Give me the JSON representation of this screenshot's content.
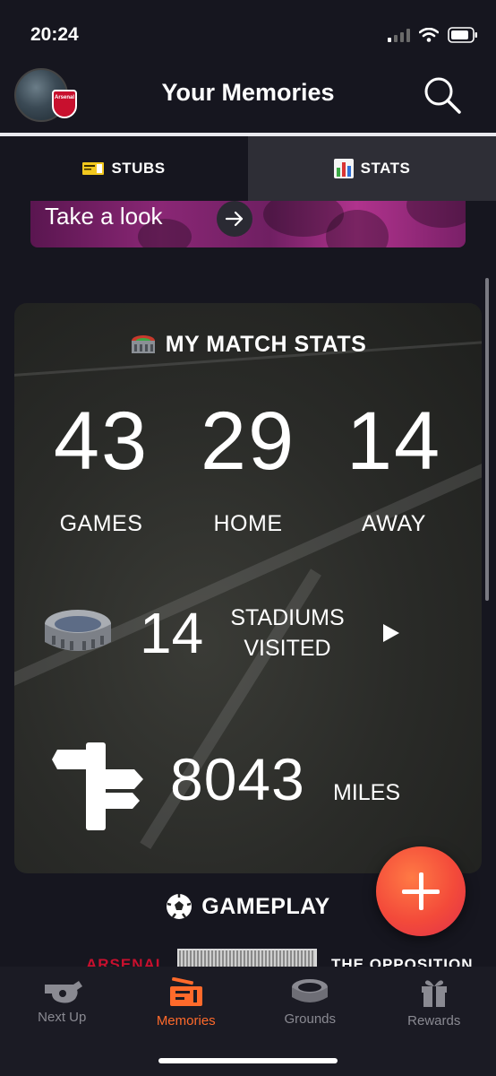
{
  "status_bar": {
    "time": "20:24"
  },
  "header": {
    "title": "Your Memories",
    "crest_text": "Arsenal"
  },
  "tabs": [
    {
      "label": "STUBS",
      "icon": "ticket-icon",
      "active": false
    },
    {
      "label": "STATS",
      "icon": "bar-chart-icon",
      "active": true
    }
  ],
  "banner": {
    "text": "Take a look"
  },
  "match_stats": {
    "title": "MY MATCH STATS",
    "games": {
      "value": "43",
      "label": "GAMES"
    },
    "home": {
      "value": "29",
      "label": "HOME"
    },
    "away": {
      "value": "14",
      "label": "AWAY"
    },
    "stadiums": {
      "value": "14",
      "label_line1": "STADIUMS",
      "label_line2": "VISITED"
    },
    "miles": {
      "value": "8043",
      "label": "MILES"
    }
  },
  "gameplay": {
    "title": "GAMEPLAY",
    "team_left": "ARSENAL",
    "team_right": "THE OPPOSITION"
  },
  "bottom_nav": [
    {
      "label": "Next Up",
      "icon": "whistle-icon",
      "active": false
    },
    {
      "label": "Memories",
      "icon": "tickets-icon",
      "active": true
    },
    {
      "label": "Grounds",
      "icon": "stadium-icon",
      "active": false
    },
    {
      "label": "Rewards",
      "icon": "gift-icon",
      "active": false
    }
  ],
  "colors": {
    "background": "#16161f",
    "accent": "#ff6a2b",
    "fab": "#f34a3a",
    "arsenal_red": "#c8102e"
  }
}
